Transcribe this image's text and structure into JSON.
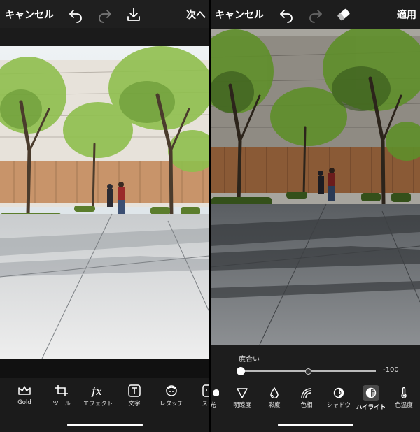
{
  "left_screen": {
    "header": {
      "cancel_label": "キャンセル",
      "next_label": "次へ"
    },
    "icons": {
      "undo": "undo-icon",
      "redo": "redo-icon",
      "download": "download-icon"
    },
    "toolbar": [
      {
        "label": "Gold",
        "icon": "crown-icon"
      },
      {
        "label": "ツール",
        "icon": "crop-icon"
      },
      {
        "label": "エフェクト",
        "icon": "fx-icon"
      },
      {
        "label": "文字",
        "icon": "text-icon"
      },
      {
        "label": "レタッチ",
        "icon": "retouch-icon"
      },
      {
        "label": "ステ",
        "icon": "sticker-icon"
      }
    ]
  },
  "right_screen": {
    "header": {
      "cancel_label": "キャンセル",
      "apply_label": "適用"
    },
    "icons": {
      "undo": "undo-icon",
      "redo": "redo-icon",
      "eraser": "eraser-icon"
    },
    "slider": {
      "label": "度合い",
      "value": "-100",
      "level_fraction": 0
    },
    "adjustments": [
      {
        "label": "光",
        "icon": "light-icon",
        "active": false
      },
      {
        "label": "明瞭度",
        "icon": "clarity-icon",
        "active": false
      },
      {
        "label": "彩度",
        "icon": "saturation-icon",
        "active": false
      },
      {
        "label": "色相",
        "icon": "hue-icon",
        "active": false
      },
      {
        "label": "シャドウ",
        "icon": "shadow-icon",
        "active": false
      },
      {
        "label": "ハイライト",
        "icon": "highlight-icon",
        "active": true
      },
      {
        "label": "色温度",
        "icon": "temperature-icon",
        "active": false
      }
    ]
  }
}
